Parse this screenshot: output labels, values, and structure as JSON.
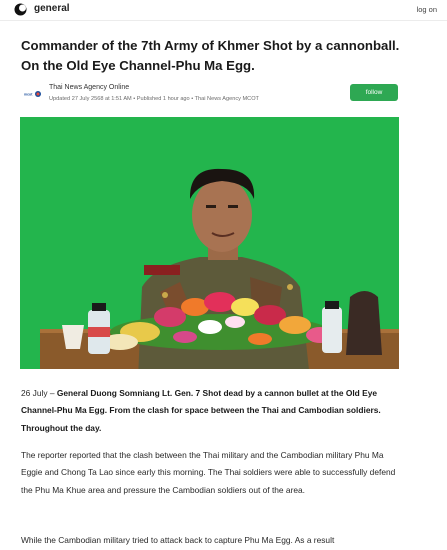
{
  "header": {
    "brand": "general",
    "login_label": "log on"
  },
  "article": {
    "title": "Commander of the 7th Army of Khmer Shot by a cannonball. On the Old Eye Channel-Phu Ma Egg.",
    "author": {
      "name": "Thai News Agency Online",
      "meta": "Updated 27 July 2568 at 1:51 AM • Published 1 hour ago • Thai News Agency MCOT"
    },
    "follow_label": "follow",
    "lead_date": "26 July –",
    "lead_bold": "General Duong Somniang Lt. Gen. 7 Shot dead by a cannon bullet at the Old Eye Channel-Phu Ma Egg. From the clash for space between the Thai and Cambodian soldiers. Throughout the day.",
    "paragraph_2": "The reporter reported that the clash between the Thai military and the Cambodian military Phu Ma Eggie and Chong Ta Lao since early this morning. The Thai soldiers were able to successfully defend the Phu Ma Khue area and pressure the Cambodian soldiers out of the area.",
    "paragraph_3": "While the Cambodian military tried to attack back to capture Phu Ma Egg. As a result"
  },
  "colors": {
    "accent_green": "#2ea853",
    "chroma_green": "#22b24c"
  },
  "icons": {
    "logo": "crescent-logo-icon",
    "avatar": "news-agency-avatar"
  }
}
